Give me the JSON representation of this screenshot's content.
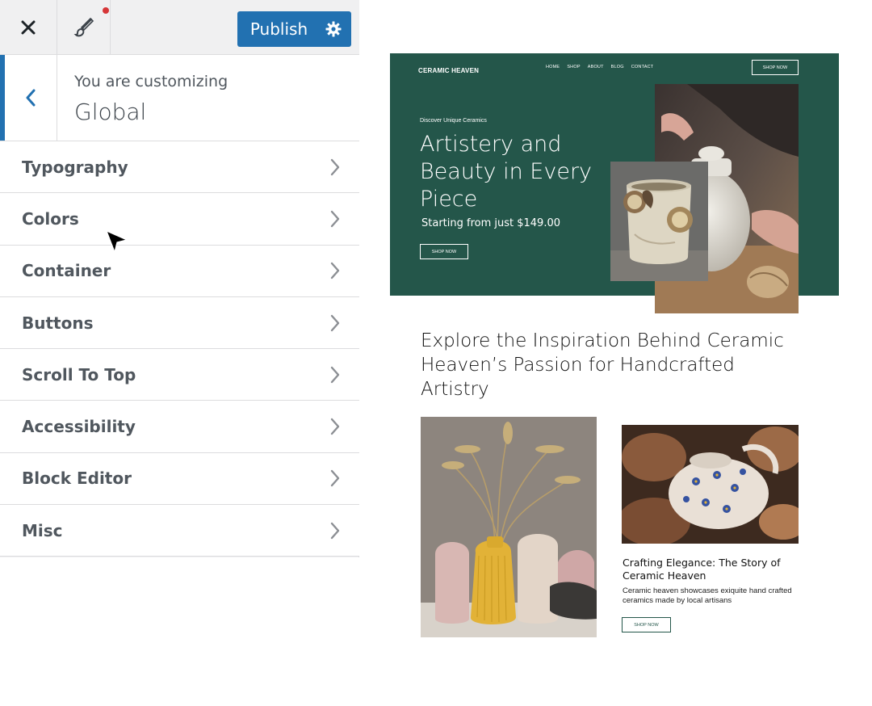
{
  "customizer": {
    "publish_label": "Publish",
    "customizing_label": "You are customizing",
    "section_title": "Global",
    "menu_items": [
      {
        "label": "Typography"
      },
      {
        "label": "Colors"
      },
      {
        "label": "Container"
      },
      {
        "label": "Buttons"
      },
      {
        "label": "Scroll To Top"
      },
      {
        "label": "Accessibility"
      },
      {
        "label": "Block Editor"
      },
      {
        "label": "Misc"
      }
    ],
    "colors": {
      "accent": "#2271b1",
      "notification": "#d63638",
      "panel_bg": "#f0f0f1"
    }
  },
  "preview": {
    "brand": "CERAMIC HEAVEN",
    "nav": [
      "HOME",
      "SHOP",
      "ABOUT",
      "BLOG",
      "CONTACT"
    ],
    "header_button": "SHOP NOW",
    "hero": {
      "kicker": "Discover Unique Ceramics",
      "heading": "Artistery and Beauty in Every Piece",
      "subheading": "Starting from just $149.00",
      "button": "SHOP NOW"
    },
    "explore_heading": "Explore the Inspiration Behind Ceramic Heaven’s Passion for Handcrafted Artistry",
    "card": {
      "title": "Crafting Elegance: The Story of Ceramic Heaven",
      "text": "Ceramic heaven showcases exiquite hand crafted ceramics made by local artisans",
      "button": "SHOP NOW"
    },
    "colors": {
      "hero_bg": "#24564a"
    }
  }
}
